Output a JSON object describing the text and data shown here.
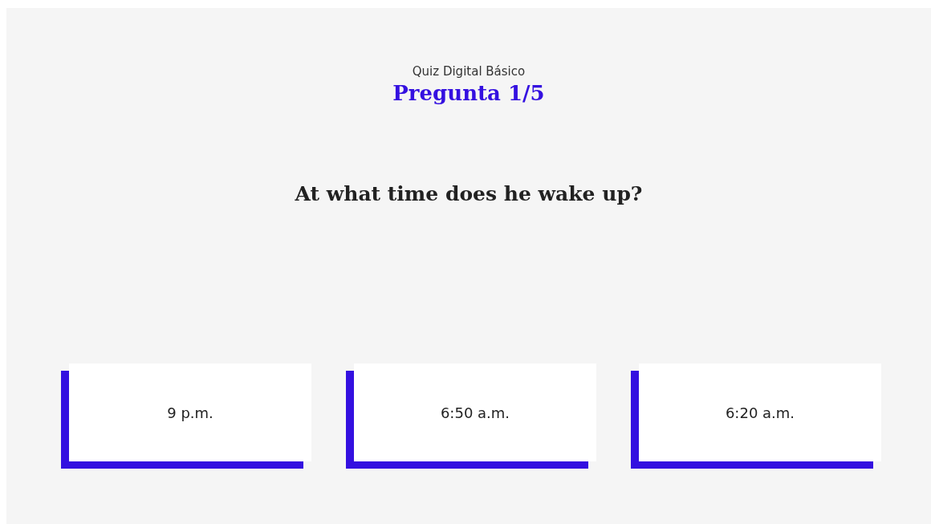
{
  "quiz": {
    "subtitle": "Quiz Digital Básico",
    "title": "Pregunta 1/5"
  },
  "question": "At what time does he wake up?",
  "options": [
    {
      "label": "9 p.m."
    },
    {
      "label": "6:50 a.m."
    },
    {
      "label": "6:20 a.m."
    }
  ]
}
